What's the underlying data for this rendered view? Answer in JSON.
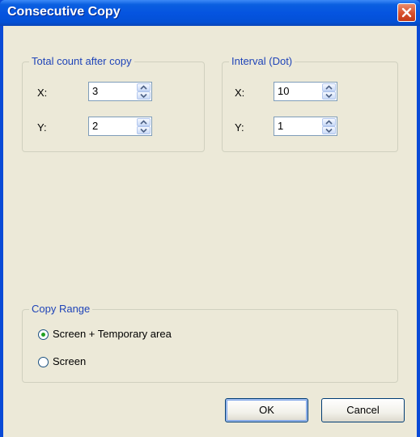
{
  "dialog": {
    "title": "Consecutive Copy",
    "close_icon": "close-icon"
  },
  "total_count": {
    "label": "Total count after copy",
    "x_label": "X:",
    "x_value": "3",
    "y_label": "Y:",
    "y_value": "2"
  },
  "interval": {
    "label": "Interval (Dot)",
    "x_label": "X:",
    "x_value": "10",
    "y_label": "Y:",
    "y_value": "1"
  },
  "copy_range": {
    "label": "Copy Range",
    "options": [
      {
        "label": "Screen + Temporary area",
        "selected": true
      },
      {
        "label": "Screen",
        "selected": false
      }
    ]
  },
  "buttons": {
    "ok": "OK",
    "cancel": "Cancel"
  },
  "colors": {
    "title_bar": "#0554e0",
    "group_label": "#1f44b8",
    "dialog_bg": "#ece9d8"
  }
}
